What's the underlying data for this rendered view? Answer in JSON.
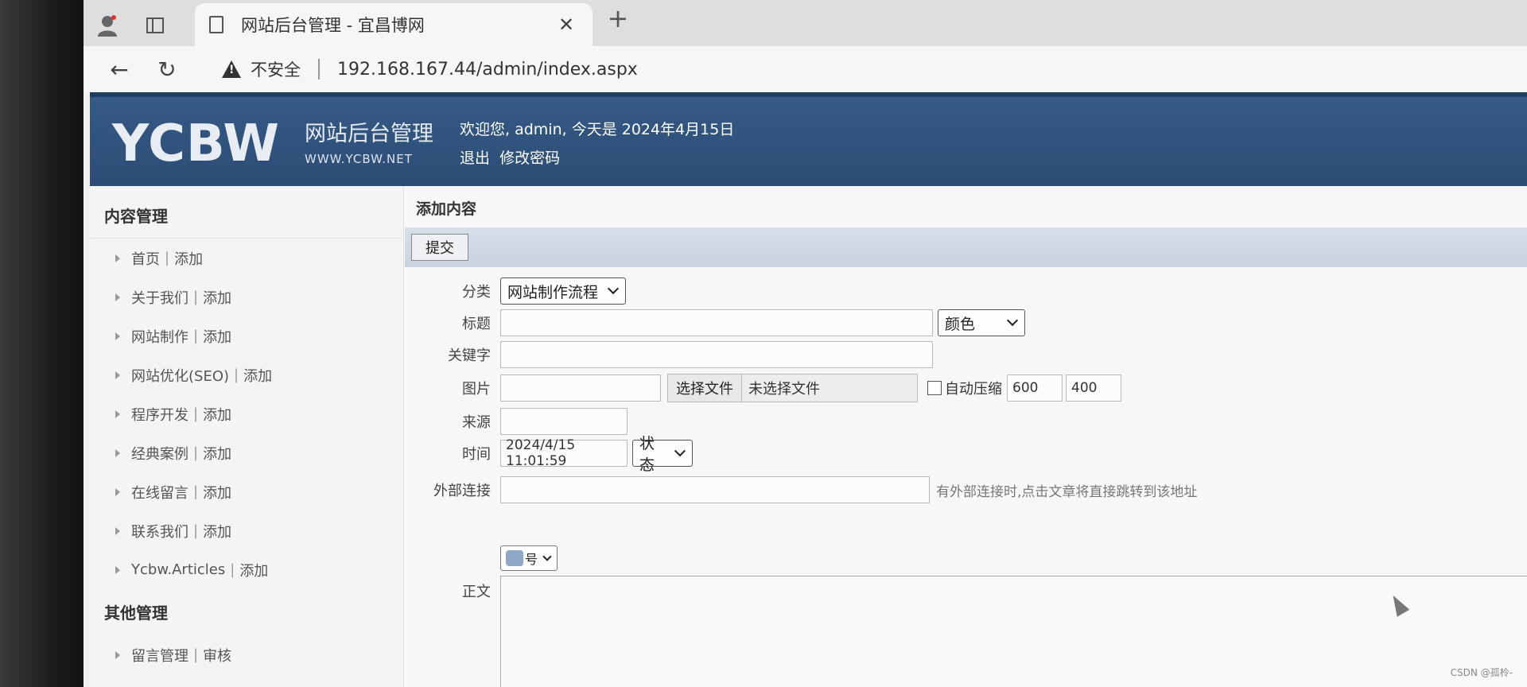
{
  "browser": {
    "tab_title": "网站后台管理 - 宜昌博网",
    "close_glyph": "✕",
    "new_tab_glyph": "+",
    "back_glyph": "←",
    "reload_glyph": "↻",
    "insecure_label": "不安全",
    "url": "192.168.167.44/admin/index.aspx"
  },
  "header": {
    "logo": "YCBW",
    "logo_cn": "网站后台管理",
    "logo_url": "WWW.YCBW.NET",
    "welcome": "欢迎您, admin, 今天是 2024年4月15日",
    "logout": "退出",
    "change_password": "修改密码"
  },
  "sidebar": {
    "heading_content": "内容管理",
    "items": [
      {
        "name": "首页",
        "action": "添加"
      },
      {
        "name": "关于我们",
        "action": "添加"
      },
      {
        "name": "网站制作",
        "action": "添加"
      },
      {
        "name": "网站优化(SEO)",
        "action": "添加"
      },
      {
        "name": "程序开发",
        "action": "添加"
      },
      {
        "name": "经典案例",
        "action": "添加"
      },
      {
        "name": "在线留言",
        "action": "添加"
      },
      {
        "name": "联系我们",
        "action": "添加"
      },
      {
        "name": "Ycbw.Articles",
        "action": "添加"
      }
    ],
    "heading_other": "其他管理",
    "other_items": [
      {
        "name": "留言管理",
        "action": "审核"
      }
    ],
    "divider": "|"
  },
  "main": {
    "title": "添加内容",
    "submit_label": "提交",
    "form": {
      "category_label": "分类",
      "category_value": "网站制作流程",
      "title_label": "标题",
      "color_value": "颜色",
      "keyword_label": "关键字",
      "image_label": "图片",
      "choose_file_label": "选择文件",
      "no_file_label": "未选择文件",
      "auto_compress_label": "自动压缩",
      "width_value": "600",
      "height_value": "400",
      "source_label": "来源",
      "time_label": "时间",
      "time_value": "2024/4/15 11:01:59",
      "status_value": "状态",
      "external_link_label": "外部连接",
      "external_link_hint": "有外部连接时,点击文章将直接跳转到该地址",
      "font_size_value": "号",
      "body_label": "正文"
    }
  },
  "watermark": "CSDN @孤柃-"
}
